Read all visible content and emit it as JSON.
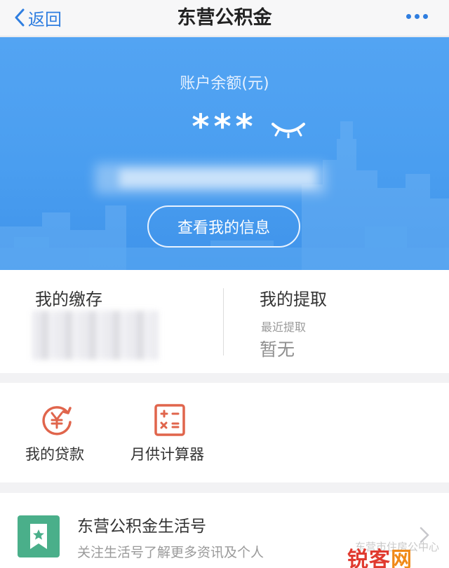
{
  "nav": {
    "back_label": "返回",
    "title": "东营公积金"
  },
  "hero": {
    "balance_label": "账户余额(元)",
    "masked_value": "***",
    "view_info_button": "查看我的信息"
  },
  "stats": {
    "deposit_title": "我的缴存",
    "withdraw_title": "我的提取",
    "recent_withdraw_label": "最近提取",
    "recent_withdraw_value": "暂无"
  },
  "tools": [
    {
      "label": "我的贷款",
      "icon": "yen-circle-icon"
    },
    {
      "label": "月供计算器",
      "icon": "calculator-icon"
    }
  ],
  "card": {
    "title": "东营公积金生活号",
    "subtitle": "关注生活号了解更多资讯及个人",
    "watermark_text": "东营市住房公",
    "watermark_tail": "中心",
    "logo_text_a": "锐客",
    "logo_text_b": "网"
  },
  "colors": {
    "accent": "#2f7ee0",
    "hero": "#4a9ef0",
    "tool_icon": "#e0654c",
    "card_icon": "#4aaf8a"
  }
}
